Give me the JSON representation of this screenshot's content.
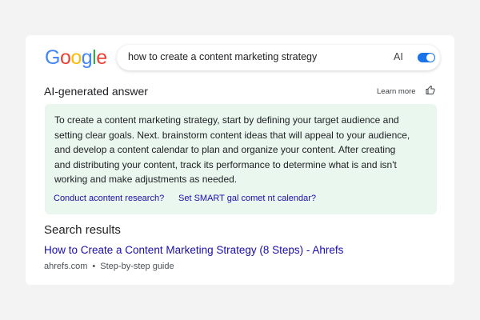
{
  "logo": {
    "letters": [
      "G",
      "o",
      "o",
      "g",
      "l",
      "e"
    ]
  },
  "search": {
    "query": "how to create a content marketing strategy",
    "ai_label": "AI",
    "ai_toggle_on": true
  },
  "ai_answer": {
    "heading": "AI-generated answer",
    "learn_more": "Learn more",
    "lines": [
      "To create a content marketing strategy, start by defining your target audience and",
      "setting clear goals. Next. brainstorm content ideas that will appeal to your audience,",
      "and develop a content calendar to plan and organize your content. After creating",
      "and distributing your content, track its performance to determine what is and isn't",
      "working and make adjustments as needed."
    ],
    "suggestions": [
      "Conduct acontent research?",
      "Set SMART gal comet nt  calendar?"
    ]
  },
  "results": {
    "heading": "Search results",
    "items": [
      {
        "title": "How to Create a Content Marketing Strategy (8 Steps) - Ahrefs",
        "source": "ahrefs.com",
        "separator": "•",
        "tag": "Step-by-step guide"
      }
    ]
  },
  "colors": {
    "google_blue": "#4285f4",
    "google_red": "#ea4335",
    "google_yellow": "#fbbc05",
    "google_green": "#34a853",
    "link": "#1a0dab",
    "answer_bg": "#e9f7ee",
    "toggle": "#1a73e8"
  }
}
